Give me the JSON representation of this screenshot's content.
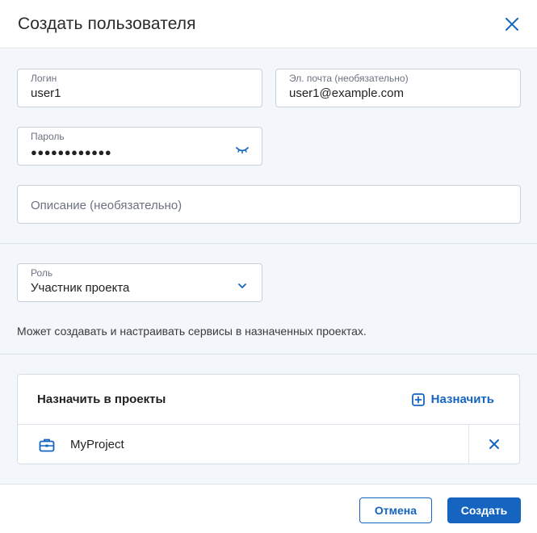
{
  "dialog": {
    "title": "Создать пользователя"
  },
  "form": {
    "login": {
      "label": "Логин",
      "value": "user1"
    },
    "email": {
      "label": "Эл. почта (необязательно)",
      "value": "user1@example.com"
    },
    "password": {
      "label": "Пароль",
      "value": "●●●●●●●●●●●●"
    },
    "description": {
      "placeholder": "Описание (необязательно)"
    },
    "role": {
      "label": "Роль",
      "value": "Участник проекта"
    },
    "role_hint": "Может создавать и настраивать сервисы в назначенных проектах."
  },
  "assign": {
    "title": "Назначить в проекты",
    "button_label": "Назначить",
    "projects": [
      {
        "name": "MyProject"
      }
    ]
  },
  "footer": {
    "cancel_label": "Отмена",
    "create_label": "Создать"
  },
  "colors": {
    "accent": "#1565c0",
    "background": "#f3f6fa",
    "border": "#c7d0dc"
  }
}
